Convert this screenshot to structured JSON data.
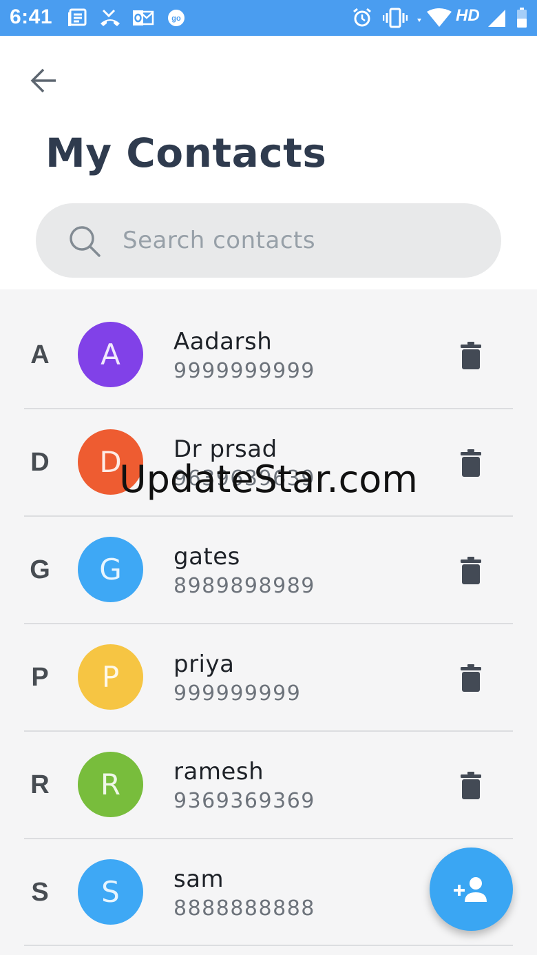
{
  "status_bar": {
    "time": "6:41",
    "network_label": "HD",
    "left_icons": [
      "notes-icon",
      "missed-call-icon",
      "outlook-icon",
      "go-icon"
    ],
    "right_icons": [
      "alarm-icon",
      "vibrate-icon",
      "wifi-icon",
      "signal-icon",
      "battery-icon"
    ]
  },
  "header": {
    "title": "My Contacts",
    "search_placeholder": "Search contacts",
    "search_value": ""
  },
  "contacts": [
    {
      "section": "A",
      "initial": "A",
      "name": "Aadarsh",
      "phone": "9999999999",
      "color": "#8141e8"
    },
    {
      "section": "D",
      "initial": "D",
      "name": "Dr prsad",
      "phone": "9639639639",
      "color": "#ee5c31"
    },
    {
      "section": "G",
      "initial": "G",
      "name": "gates",
      "phone": "8989898989",
      "color": "#3ea8f5"
    },
    {
      "section": "P",
      "initial": "P",
      "name": "priya",
      "phone": "999999999",
      "color": "#f6c543"
    },
    {
      "section": "R",
      "initial": "R",
      "name": "ramesh",
      "phone": "9369369369",
      "color": "#78bd3c"
    },
    {
      "section": "S",
      "initial": "S",
      "name": "sam",
      "phone": "8888888888",
      "color": "#3ea8f5"
    }
  ],
  "watermark": "UpdateStar.com",
  "colors": {
    "status_bar": "#4a9df0",
    "title": "#2f3b4e",
    "fab": "#3aa6f3",
    "delete_icon": "#434a55"
  }
}
